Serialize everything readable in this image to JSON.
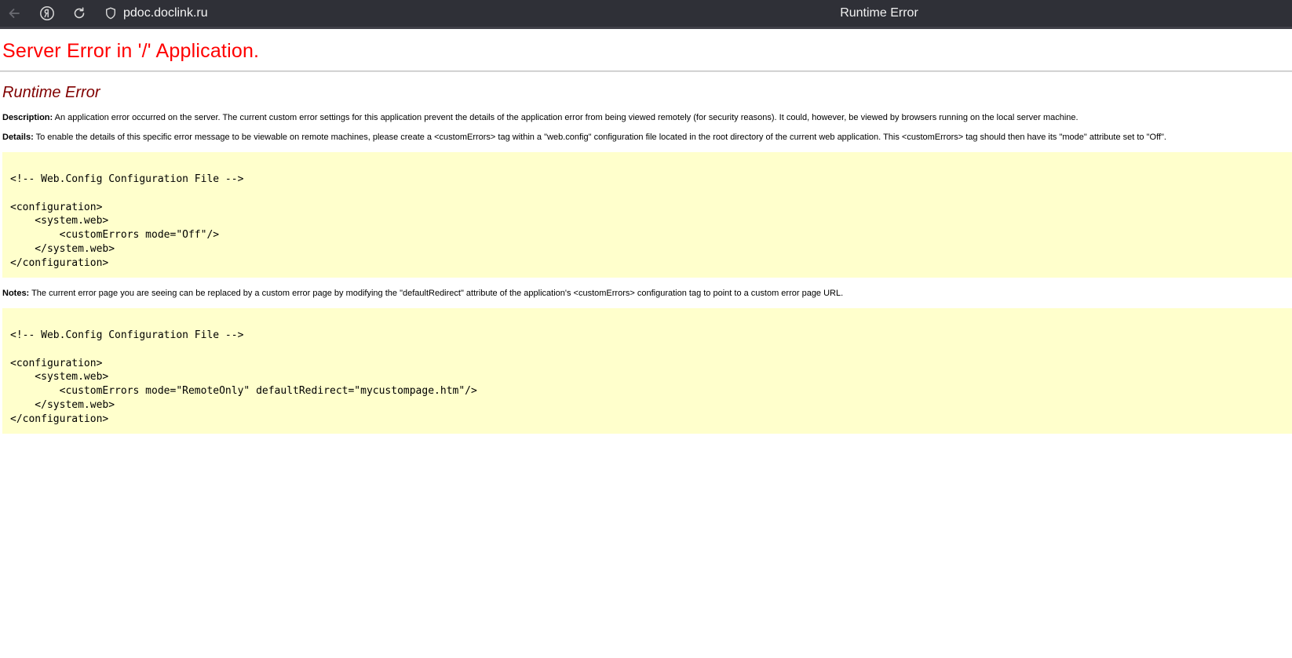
{
  "browser": {
    "url": "pdoc.doclink.ru",
    "tab_title": "Runtime Error"
  },
  "page": {
    "heading": "Server Error in '/' Application.",
    "subheading": "Runtime Error",
    "description_label": "Description:",
    "description_text": " An application error occurred on the server. The current custom error settings for this application prevent the details of the application error from being viewed remotely (for security reasons). It could, however, be viewed by browsers running on the local server machine.",
    "details_label": "Details:",
    "details_text": " To enable the details of this specific error message to be viewable on remote machines, please create a <customErrors> tag within a \"web.config\" configuration file located in the root directory of the current web application. This <customErrors> tag should then have its \"mode\" attribute set to \"Off\".",
    "code_sample_1": "<!-- Web.Config Configuration File -->\n\n<configuration>\n    <system.web>\n        <customErrors mode=\"Off\"/>\n    </system.web>\n</configuration>",
    "notes_label": "Notes:",
    "notes_text": " The current error page you are seeing can be replaced by a custom error page by modifying the \"defaultRedirect\" attribute of the application's <customErrors> configuration tag to point to a custom error page URL.",
    "code_sample_2": "<!-- Web.Config Configuration File -->\n\n<configuration>\n    <system.web>\n        <customErrors mode=\"RemoteOnly\" defaultRedirect=\"mycustompage.htm\"/>\n    </system.web>\n</configuration>"
  },
  "colors": {
    "heading": "#ff0000",
    "subheading": "#800000",
    "code_background": "#ffffcc",
    "chrome_background": "#2f3037"
  },
  "icons": {
    "back": "arrow-left-icon",
    "yandex": "yandex-logo-icon",
    "reload": "reload-icon",
    "security": "shield-icon"
  }
}
